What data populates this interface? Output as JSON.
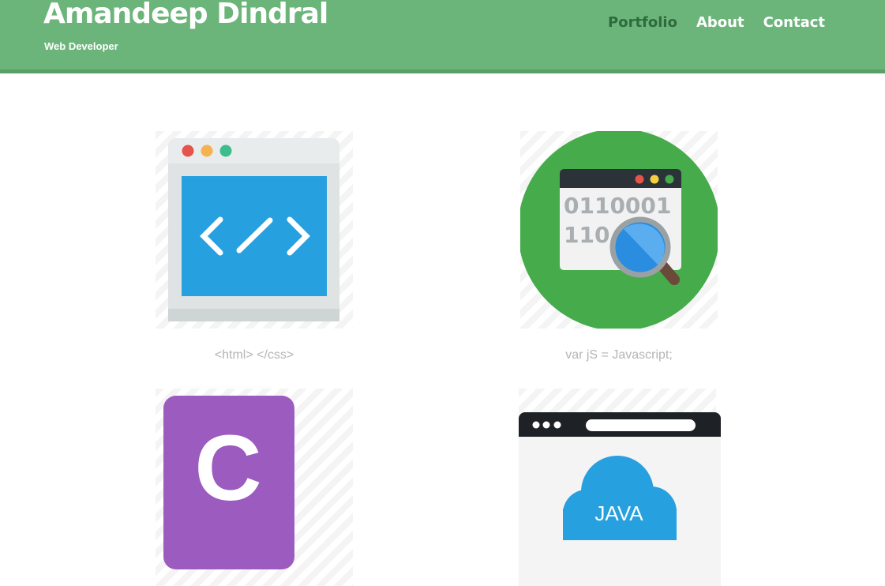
{
  "site": {
    "name": "Amandeep Dindral",
    "tagline": "Web Developer"
  },
  "nav": {
    "items": [
      {
        "label": "Portfolio",
        "active": true
      },
      {
        "label": "About",
        "active": false
      },
      {
        "label": "Contact",
        "active": false
      }
    ]
  },
  "portfolio": {
    "items": [
      {
        "caption": "<html> </css>",
        "icon": "code-window-icon"
      },
      {
        "caption": "var jS = Javascript;",
        "icon": "binary-search-icon",
        "binary_lines": [
          "0110001",
          "110"
        ]
      },
      {
        "caption": "",
        "icon": "c-language-icon",
        "letter": "C"
      },
      {
        "caption": "",
        "icon": "java-cloud-icon",
        "label": "JAVA"
      }
    ]
  },
  "colors": {
    "header_bg": "#6cb57a",
    "nav_active": "#2e6b3c",
    "caption": "#b5b5b5"
  }
}
